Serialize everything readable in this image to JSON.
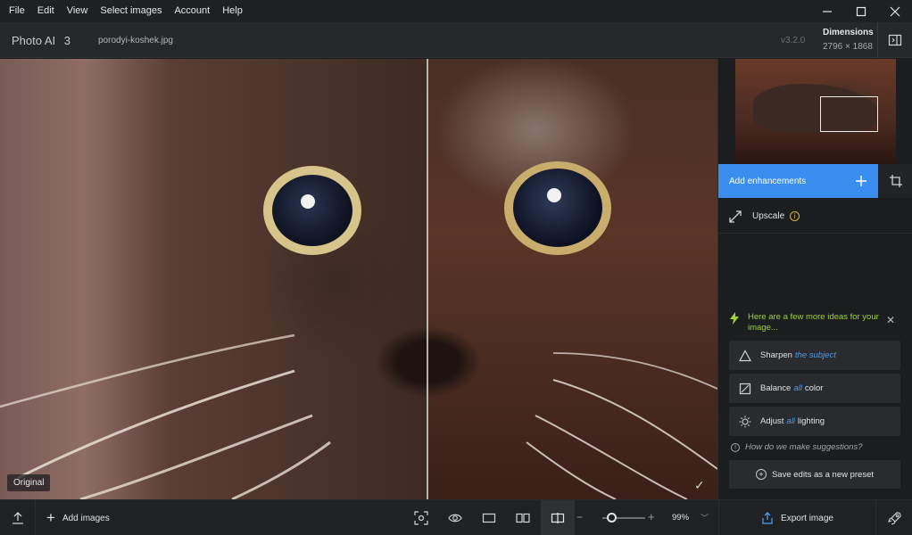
{
  "menu": [
    "File",
    "Edit",
    "View",
    "Select images",
    "Account",
    "Help"
  ],
  "header": {
    "app_title": "Photo AI",
    "app_version_number": "3",
    "filename": "porodyi-koshek.jpg",
    "version": "v3.2.0",
    "dimensions_label": "Dimensions",
    "dimensions_value": "2796 × 1868"
  },
  "canvas": {
    "original_label": "Original"
  },
  "panel": {
    "add_enhancements": "Add enhancements",
    "upscale": "Upscale",
    "ideas_text": "Here are a few more ideas for your image...",
    "suggestions": [
      {
        "verb": "Sharpen",
        "highlight": "the subject",
        "rest": ""
      },
      {
        "verb": "Balance",
        "highlight": "all",
        "rest": "color"
      },
      {
        "verb": "Adjust",
        "highlight": "all",
        "rest": "lighting"
      }
    ],
    "how_text": "How do we make suggestions?",
    "save_preset": "Save edits as a new preset"
  },
  "bottom": {
    "add_images": "Add images",
    "zoom": "99%",
    "zoom_level": 0.4,
    "export": "Export image"
  },
  "colors": {
    "accent": "#3a8ef0",
    "ideas_green": "#9bd62c",
    "info_yellow": "#d8b73a"
  }
}
